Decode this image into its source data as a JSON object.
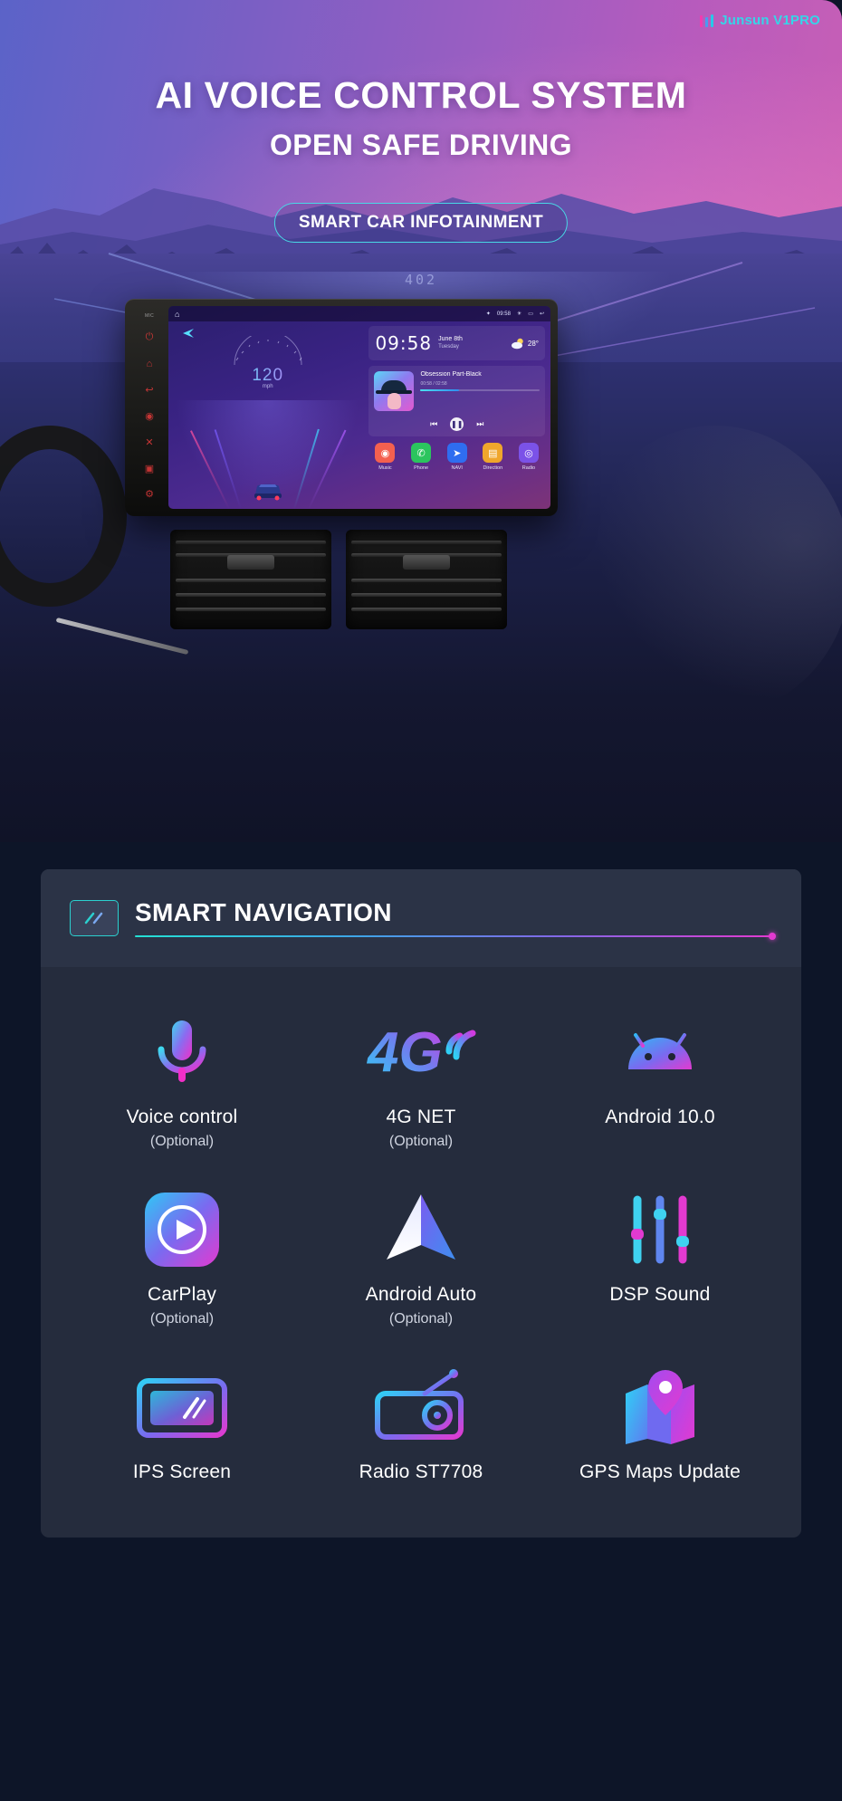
{
  "brand": {
    "name": "Junsun V1PRO",
    "bars_icon": "signal-bars-icon"
  },
  "hero": {
    "title": "AI VOICE CONTROL SYSTEM",
    "subtitle": "OPEN SAFE DRIVING",
    "pill_label": "SMART CAR INFOTAINMENT",
    "hud_text": "402"
  },
  "headunit": {
    "status": {
      "home_icon": "home-icon",
      "time": "09:58",
      "brightness_icon": "brightness-icon",
      "screenshot_icon": "screenshot-icon",
      "back-icon": "back-icon"
    },
    "sidebar_icons": [
      "location-icon",
      "bluetooth-icon",
      "apps-icon",
      "camera-icon",
      "settings-icon"
    ],
    "speed": {
      "value": "120",
      "unit": "mph"
    },
    "clock": {
      "time": "09:58",
      "date": "June 8th",
      "weekday": "Tuesday",
      "temp": "28°",
      "weather_icon": "partly-cloudy-icon"
    },
    "music": {
      "title": "Obsession Part-Black",
      "time": "00:58 / 02:58",
      "progress_percent": 32,
      "prev_icon": "prev-track-icon",
      "play_icon": "pause-icon",
      "next_icon": "next-track-icon"
    },
    "apps": [
      {
        "label": "Music",
        "icon": "music-icon",
        "color": "#f4604f"
      },
      {
        "label": "Phone",
        "icon": "phone-icon",
        "color": "#2bc55e"
      },
      {
        "label": "NAVI",
        "icon": "navigation-arrow-icon",
        "color": "#2f6df0"
      },
      {
        "label": "Direction",
        "icon": "direction-icon",
        "color": "#f0a62c"
      },
      {
        "label": "Radio",
        "icon": "radio-icon",
        "color": "#7b52e8"
      }
    ]
  },
  "section": {
    "badge_icon": "slashes-icon",
    "title": "SMART NAVIGATION",
    "accent_start": "#24e0d4",
    "accent_end": "#e23ad0"
  },
  "features": [
    {
      "label": "Voice control",
      "note": "(Optional)",
      "icon": "microphone-icon"
    },
    {
      "label": "4G NET",
      "note": "(Optional)",
      "icon": "4g-signal-icon"
    },
    {
      "label": "Android 10.0",
      "note": "",
      "icon": "android-icon"
    },
    {
      "label": "CarPlay",
      "note": "(Optional)",
      "icon": "carplay-icon"
    },
    {
      "label": "Android Auto",
      "note": "(Optional)",
      "icon": "android-auto-icon"
    },
    {
      "label": "DSP Sound",
      "note": "",
      "icon": "dsp-sliders-icon"
    },
    {
      "label": "IPS Screen",
      "note": "",
      "icon": "ips-screen-icon"
    },
    {
      "label": "Radio ST7708",
      "note": "",
      "icon": "radio-device-icon"
    },
    {
      "label": "GPS Maps Update",
      "note": "",
      "icon": "gps-map-icon"
    }
  ]
}
